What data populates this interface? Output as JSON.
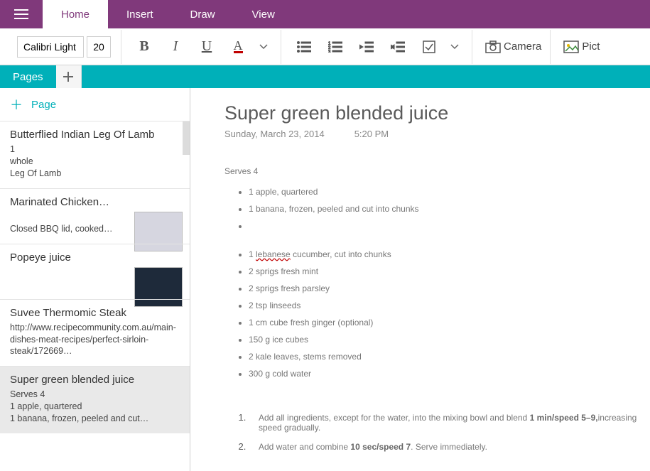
{
  "tabs": {
    "home": "Home",
    "insert": "Insert",
    "draw": "Draw",
    "view": "View"
  },
  "ribbon": {
    "font": "Calibri Light",
    "size": "20",
    "camera": "Camera",
    "pictures": "Pict"
  },
  "teal": {
    "pages": "Pages"
  },
  "sidebar": {
    "addPage": "Page",
    "items": [
      {
        "title": "Butterflied Indian Leg Of Lamb",
        "preview": "1\nwhole\nLeg Of Lamb",
        "thumb": ""
      },
      {
        "title": "Marinated Chicken…",
        "preview": "\nClosed BBQ lid, cooked…",
        "thumb": "light"
      },
      {
        "title": "Popeye juice",
        "preview": "",
        "thumb": "dark"
      },
      {
        "title": "Suvee Thermomic Steak",
        "preview": "http://www.recipecommunity.com.au/main-dishes-meat-recipes/perfect-sirloin-steak/172669…",
        "thumb": ""
      },
      {
        "title": "Super green blended juice",
        "preview": "Serves 4\n1 apple, quartered\n1 banana, frozen, peeled and cut…",
        "thumb": "",
        "selected": true
      }
    ]
  },
  "doc": {
    "title": "Super green blended juice",
    "date": "Sunday, March 23, 2014",
    "time": "5:20 PM",
    "serves": "Serves 4",
    "ing1": [
      "1 apple, quartered",
      "1 banana, frozen, peeled and cut into chunks",
      ""
    ],
    "ing2": [
      {
        "pre": "1 ",
        "sq": "lebanese",
        "post": " cucumber, cut into chunks"
      },
      "2 sprigs fresh mint",
      "2 sprigs fresh parsley",
      "2 tsp linseeds",
      "1 cm cube fresh ginger (optional)",
      "150 g ice cubes",
      "2 kale leaves, stems removed",
      "300 g cold water"
    ],
    "steps": [
      {
        "pre": "Add all ingredients, except for the water, into the mixing bowl and blend ",
        "b": "1 min/speed 5–9,",
        "post": "increasing speed gradually."
      },
      {
        "pre": "Add water and combine ",
        "b": "10 sec/speed 7",
        "post": ". Serve immediately."
      }
    ]
  }
}
